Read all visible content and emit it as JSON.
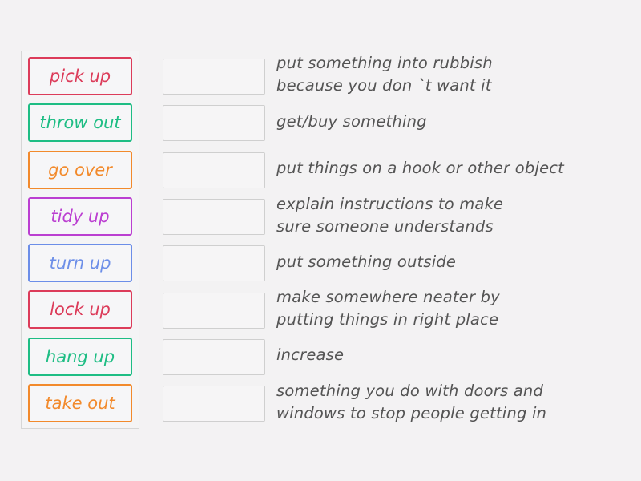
{
  "activity": {
    "type": "match-up",
    "words": [
      {
        "label": "pick up",
        "color": "#dc3c5a"
      },
      {
        "label": "throw out",
        "color": "#1ebd84"
      },
      {
        "label": "go over",
        "color": "#f28a2c"
      },
      {
        "label": "tidy up",
        "color": "#bb3fd1"
      },
      {
        "label": "turn up",
        "color": "#6c8ee8"
      },
      {
        "label": "lock up",
        "color": "#dc3c5a"
      },
      {
        "label": "hang up",
        "color": "#1ebd84"
      },
      {
        "label": "take out",
        "color": "#f28a2c"
      }
    ],
    "definitions": [
      "put something into rubbish\nbecause you don `t want it",
      "get/buy something",
      "put things on a hook or other object",
      "explain instructions to make\nsure someone understands",
      "put something outside",
      "make somewhere neater by\nputting things in right place",
      "increase",
      "something you do with doors and\nwindows to stop people getting in"
    ]
  }
}
